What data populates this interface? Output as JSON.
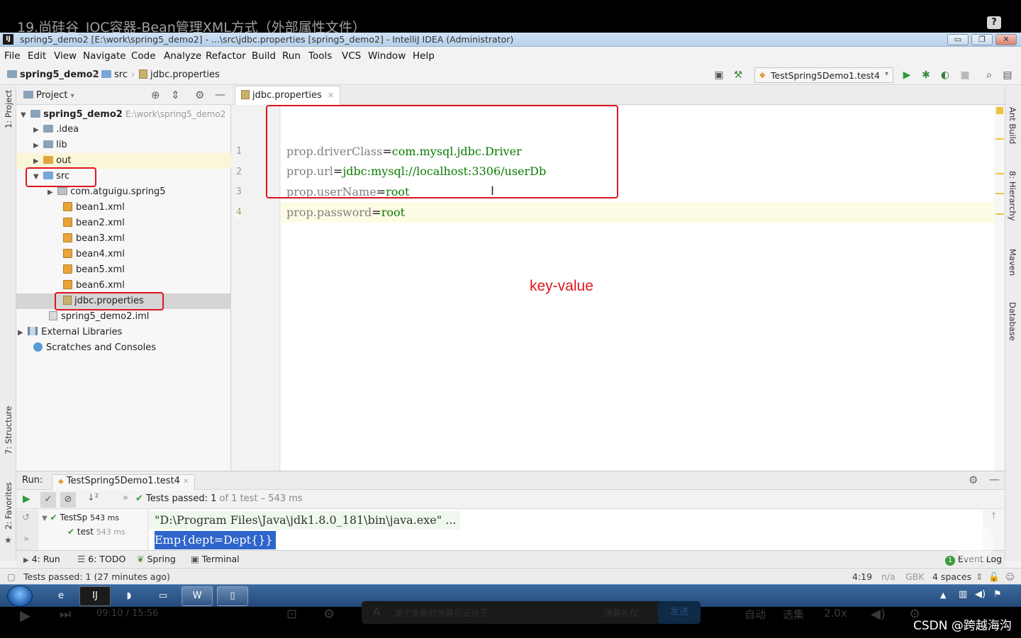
{
  "video": {
    "title": "19.尚硅谷_IOC容器-Bean管理XML方式（外部属性文件）",
    "help": "?"
  },
  "window": {
    "logo": "IJ",
    "title": "spring5_demo2 [E:\\work\\spring5_demo2] - ...\\src\\jdbc.properties [spring5_demo2] - IntelliJ IDEA (Administrator)",
    "minimize": "▭",
    "restore": "❐",
    "close": "✕"
  },
  "menu": [
    "File",
    "Edit",
    "View",
    "Navigate",
    "Code",
    "Analyze",
    "Refactor",
    "Build",
    "Run",
    "Tools",
    "VCS",
    "Window",
    "Help"
  ],
  "breadcrumb": {
    "project": "spring5_demo2",
    "folder": "src",
    "file": "jdbc.properties"
  },
  "toolbar": {
    "run_config": "TestSpring5Demo1.test4"
  },
  "left_tabs": {
    "project": "1: Project",
    "structure": "7: Structure",
    "favorites": "2: Favorites"
  },
  "right_tabs": {
    "ant": "Ant Build",
    "hierarchy": "8: Hierarchy",
    "maven": "Maven",
    "database": "Database"
  },
  "project_panel": {
    "title": "Project",
    "root": {
      "name": "spring5_demo2",
      "path": "E:\\work\\spring5_demo2"
    },
    "nodes": {
      "idea": ".idea",
      "lib": "lib",
      "out": "out",
      "src": "src",
      "pkg": "com.atguigu.spring5",
      "bean1": "bean1.xml",
      "bean2": "bean2.xml",
      "bean3": "bean3.xml",
      "bean4": "bean4.xml",
      "bean5": "bean5.xml",
      "bean6": "bean6.xml",
      "props": "jdbc.properties",
      "iml": "spring5_demo2.iml",
      "ext": "External Libraries",
      "scratch": "Scratches and Consoles"
    }
  },
  "editor": {
    "tab": "jdbc.properties",
    "lines": [
      {
        "num": "1",
        "key": "prop.driverClass",
        "eq": "=",
        "value": "com.mysql.jdbc.Driver"
      },
      {
        "num": "2",
        "key": "prop.url",
        "eq": "=",
        "value": "jdbc:mysql://localhost:3306/userDb"
      },
      {
        "num": "3",
        "key": "prop.userName",
        "eq": "=",
        "value": "root"
      },
      {
        "num": "4",
        "key": "prop.password",
        "eq": "=",
        "value": "root"
      }
    ],
    "annotation": "key-value"
  },
  "run_panel": {
    "label": "Run:",
    "tab": "TestSpring5Demo1.test4",
    "status_prefix": "Tests passed:",
    "status_count": "1",
    "status_rest": "of 1 test – 543 ms",
    "tree_suite": "TestSp",
    "tree_suite_time": "543 ms",
    "tree_test": "test",
    "tree_test_time": "543 ms",
    "console_cmd": "\"D:\\Program Files\\Java\\jdk1.8.0_181\\bin\\java.exe\" ...",
    "console_out": "Emp{dept=Dept{}}"
  },
  "tool_windows": {
    "run": "4: Run",
    "todo": "6: TODO",
    "spring": "Spring",
    "terminal": "Terminal",
    "event_log": "Event Log",
    "event_count": "1"
  },
  "status": {
    "message": "Tests passed: 1 (27 minutes ago)",
    "position": "4:19",
    "na": "n/a",
    "encoding": "GBK",
    "indent": "4 spaces"
  },
  "player": {
    "time": "09:10 / 15:56",
    "danmaku_placeholder": "发个友善的弹幕见证当下",
    "etiquette": "弹幕礼仪",
    "send": "发送",
    "auto": "自动",
    "episodes": "选集",
    "speed": "2.0x"
  },
  "watermark": "CSDN @跨越海沟"
}
